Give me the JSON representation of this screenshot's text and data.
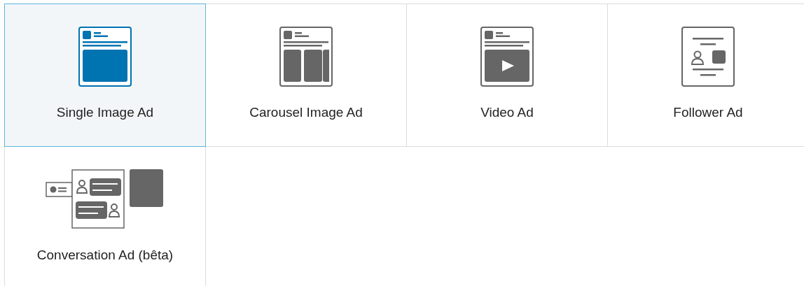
{
  "ad_formats": [
    {
      "label": "Single Image Ad",
      "kind": "single",
      "selected": true
    },
    {
      "label": "Carousel Image Ad",
      "kind": "carousel",
      "selected": false
    },
    {
      "label": "Video Ad",
      "kind": "video",
      "selected": false
    },
    {
      "label": "Follower Ad",
      "kind": "follower",
      "selected": false
    },
    {
      "label": "Conversation Ad (bêta)",
      "kind": "conversation",
      "selected": false
    }
  ]
}
